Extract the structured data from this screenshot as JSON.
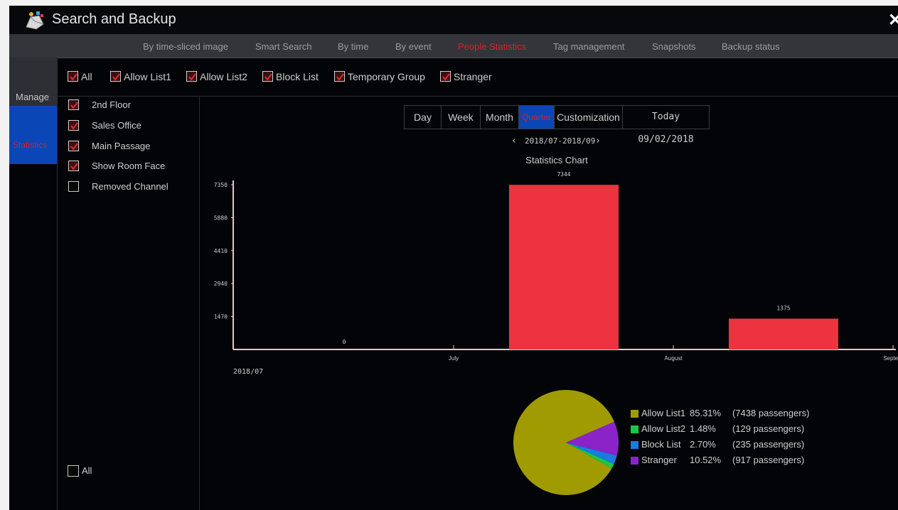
{
  "window": {
    "title": "Search and Backup",
    "close_icon": "close-icon"
  },
  "tabs": [
    {
      "label": "By time-sliced image",
      "active": false
    },
    {
      "label": "Smart Search",
      "active": false
    },
    {
      "label": "By time",
      "active": false
    },
    {
      "label": "By event",
      "active": false
    },
    {
      "label": "People Statistics",
      "active": true
    },
    {
      "label": "Tag management",
      "active": false
    },
    {
      "label": "Snapshots",
      "active": false
    },
    {
      "label": "Backup status",
      "active": false
    }
  ],
  "sidebar": {
    "items": [
      {
        "label": "Manage",
        "active": false
      },
      {
        "label": "Statistics",
        "active": true
      }
    ]
  },
  "filters": [
    {
      "label": "All",
      "checked": true
    },
    {
      "label": "Allow List1",
      "checked": true
    },
    {
      "label": "Allow List2",
      "checked": true
    },
    {
      "label": "Block List",
      "checked": true
    },
    {
      "label": "Temporary Group",
      "checked": true
    },
    {
      "label": "Stranger",
      "checked": true
    }
  ],
  "channels": [
    {
      "label": "2nd Floor",
      "checked": true
    },
    {
      "label": "Sales Office",
      "checked": true
    },
    {
      "label": "Main Passage",
      "checked": true
    },
    {
      "label": "Show Room Face",
      "checked": true
    },
    {
      "label": "Removed Channel",
      "checked": false
    }
  ],
  "channels_all": {
    "label": "All",
    "checked": false
  },
  "period": {
    "options": [
      "Day",
      "Week",
      "Month",
      "Quarter",
      "Customization"
    ],
    "active": "Quarter",
    "today_label": "Today 09/02/2018"
  },
  "range": {
    "label": "2018/07-2018/09",
    "prev_icon": "chevron-left-icon",
    "next_icon": "chevron-right-icon"
  },
  "colors": {
    "bar": "#ee3340",
    "axis": "#e8c8cc",
    "active_tab": "#d8202a",
    "active_bg": "#0b46b6"
  },
  "chart_data": [
    {
      "type": "bar",
      "title": "Statistics Chart",
      "x_start_label": "2018/07",
      "x_ticks": [
        "July",
        "August",
        "Septem"
      ],
      "y_ticks": [
        1470,
        2940,
        4410,
        5880,
        7350
      ],
      "ylim": [
        0,
        7350
      ],
      "categories": [
        "2018/07",
        "2018/08",
        "2018/09"
      ],
      "values": [
        0,
        7344,
        1375
      ],
      "data_labels": [
        "0",
        "7344",
        "1375"
      ]
    },
    {
      "type": "pie",
      "series": [
        {
          "name": "Allow List1",
          "percent": "85.31%",
          "count_label": "(7438 passengers)",
          "value": 85.31,
          "color": "#a19b02"
        },
        {
          "name": "Allow List2",
          "percent": "1.48%",
          "count_label": "(129 passengers)",
          "value": 1.48,
          "color": "#16c84a"
        },
        {
          "name": "Block List",
          "percent": "2.70%",
          "count_label": "(235 passengers)",
          "value": 2.7,
          "color": "#1a7be0"
        },
        {
          "name": "Stranger",
          "percent": "10.52%",
          "count_label": "(917 passengers)",
          "value": 10.52,
          "color": "#8a24c8"
        }
      ]
    }
  ]
}
